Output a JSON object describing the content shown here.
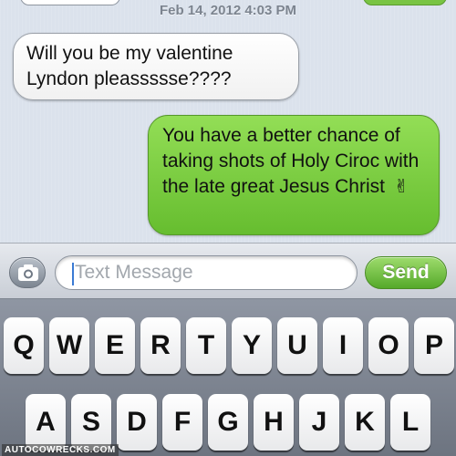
{
  "conversation": {
    "timestamp": "Feb 14, 2012 4:03 PM",
    "messages": [
      {
        "direction": "received",
        "text": "Will you be my valentine Lyndon pleassssse????"
      },
      {
        "direction": "sent",
        "text": "You have a better chance of taking shots of Holy Ciroc with the late great Jesus Christ",
        "emoji": "✌"
      }
    ]
  },
  "compose": {
    "placeholder": "Text Message",
    "send_label": "Send",
    "camera_icon": "camera-icon"
  },
  "keyboard": {
    "row1": [
      "Q",
      "W",
      "E",
      "R",
      "T",
      "Y",
      "U",
      "I",
      "O",
      "P"
    ],
    "row2": [
      "A",
      "S",
      "D",
      "F",
      "G",
      "H",
      "J",
      "K",
      "L"
    ]
  },
  "watermark": {
    "text": "AUTOCOWRECKS.COM"
  },
  "colors": {
    "sent_bubble": "#79c443",
    "received_bubble": "#ffffff",
    "send_button": "#5fb22f",
    "conversation_bg": "#dbe2ec"
  }
}
